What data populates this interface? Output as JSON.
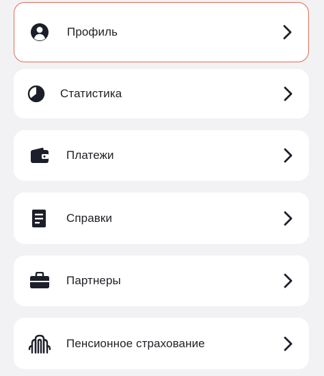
{
  "menu": {
    "items": [
      {
        "label": "Профиль",
        "icon": "profile-icon",
        "selected": true
      },
      {
        "label": "Статистика",
        "icon": "statistics-pie-icon",
        "selected": false
      },
      {
        "label": "Платежи",
        "icon": "wallet-icon",
        "selected": false
      },
      {
        "label": "Справки",
        "icon": "document-icon",
        "selected": false
      },
      {
        "label": "Партнеры",
        "icon": "briefcase-icon",
        "selected": false
      },
      {
        "label": "Пенсионное страхование",
        "icon": "pension-logo-icon",
        "selected": false
      }
    ],
    "chevron_icon": "chevron-right-icon"
  },
  "colors": {
    "background": "#f2f2f4",
    "card": "#ffffff",
    "selected_border": "#dd6a55",
    "text": "#1e1f24",
    "icon": "#1c1f2a"
  }
}
